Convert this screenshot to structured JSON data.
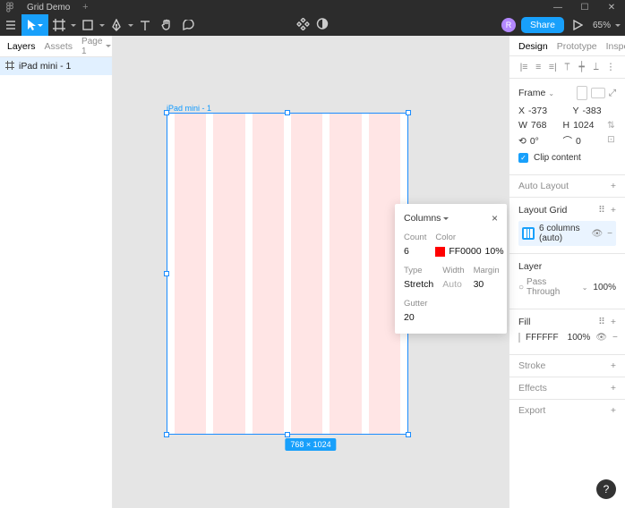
{
  "titlebar": {
    "filename": "Grid Demo",
    "newtab": "+"
  },
  "toolbar": {
    "zoom": "65%",
    "share": "Share",
    "avatar": "R"
  },
  "left": {
    "tabs": {
      "layers": "Layers",
      "assets": "Assets",
      "page": "Page 1"
    },
    "layer1": "iPad mini - 1"
  },
  "canvas": {
    "frame_label": "iPad mini - 1",
    "size_badge": "768 × 1024"
  },
  "popup": {
    "title": "Columns",
    "count_label": "Count",
    "count": "6",
    "color_label": "Color",
    "color_hex": "FF0000",
    "color_opacity": "10%",
    "type_label": "Type",
    "type": "Stretch",
    "width_label": "Width",
    "width": "Auto",
    "margin_label": "Margin",
    "margin": "30",
    "gutter_label": "Gutter",
    "gutter": "20"
  },
  "right": {
    "tabs": {
      "design": "Design",
      "prototype": "Prototype",
      "inspect": "Inspect"
    },
    "frame": {
      "title": "Frame",
      "x": "-373",
      "y": "-383",
      "w": "768",
      "h": "1024",
      "rotation": "0°",
      "radius": "0",
      "clip": "Clip content"
    },
    "autolayout": "Auto Layout",
    "layoutgrid": {
      "title": "Layout Grid",
      "item": "6 columns (auto)"
    },
    "layer": {
      "title": "Layer",
      "blend": "Pass Through",
      "opacity": "100%"
    },
    "fill": {
      "title": "Fill",
      "hex": "FFFFFF",
      "opacity": "100%"
    },
    "stroke": "Stroke",
    "effects": "Effects",
    "export": "Export"
  },
  "help": "?"
}
